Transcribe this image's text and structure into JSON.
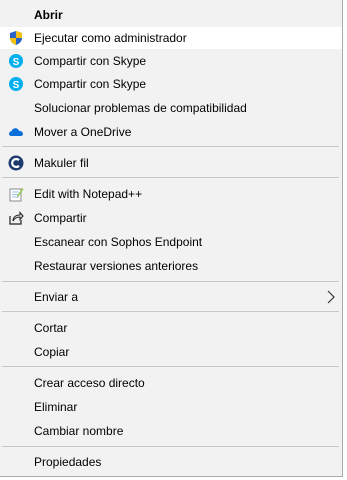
{
  "menu": {
    "items": [
      {
        "label": "Abrir"
      },
      {
        "label": "Ejecutar como administrador",
        "icon": "uac-shield-icon"
      },
      {
        "label": "Compartir con Skype",
        "icon": "skype-icon"
      },
      {
        "label": "Compartir con Skype",
        "icon": "skype-icon"
      },
      {
        "label": "Solucionar problemas de compatibilidad"
      },
      {
        "label": "Mover a OneDrive",
        "icon": "onedrive-cloud-icon"
      },
      {
        "label": "Makuler fil",
        "icon": "ccleaner-icon"
      },
      {
        "label": "Edit with Notepad++",
        "icon": "notepad-plus-plus-icon"
      },
      {
        "label": "Compartir",
        "icon": "share-icon"
      },
      {
        "label": "Escanear con Sophos Endpoint"
      },
      {
        "label": "Restaurar versiones anteriores"
      },
      {
        "label": "Enviar a",
        "submenu": true
      },
      {
        "label": "Cortar"
      },
      {
        "label": "Copiar"
      },
      {
        "label": "Crear acceso directo"
      },
      {
        "label": "Eliminar"
      },
      {
        "label": "Cambiar nombre"
      },
      {
        "label": "Propiedades"
      }
    ]
  },
  "colors": {
    "menu_background": "#f2f2f2",
    "hover_background": "#ffffff",
    "separator": "#c8c8c8",
    "skype_blue": "#00aff0",
    "onedrive_blue": "#0a6fd8"
  }
}
